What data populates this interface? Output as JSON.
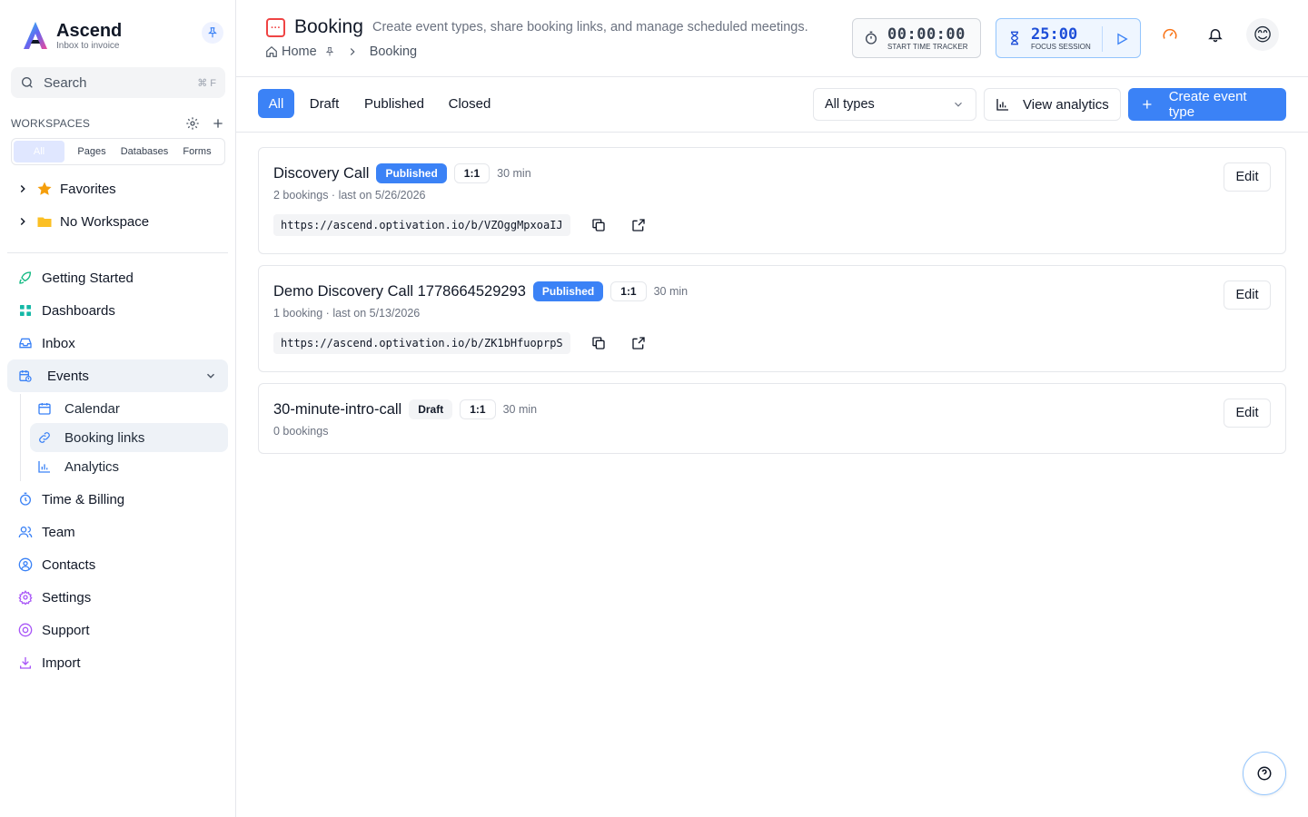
{
  "brand": {
    "name": "Ascend",
    "tagline": "Inbox to invoice"
  },
  "search": {
    "placeholder": "Search",
    "shortcut": "⌘ F"
  },
  "workspaces": {
    "title": "WORKSPACES",
    "tabs": [
      "All",
      "Pages",
      "Databases",
      "Forms"
    ],
    "tree": [
      {
        "label": "Favorites",
        "icon": "star-icon"
      },
      {
        "label": "No Workspace",
        "icon": "folder-icon"
      }
    ]
  },
  "nav": {
    "items": [
      {
        "label": "Getting Started",
        "icon": "rocket-icon"
      },
      {
        "label": "Dashboards",
        "icon": "grid-icon"
      },
      {
        "label": "Inbox",
        "icon": "inbox-icon"
      },
      {
        "label": "Events",
        "icon": "calendar-clock-icon"
      }
    ],
    "events_sub": [
      {
        "label": "Calendar",
        "icon": "calendar-icon"
      },
      {
        "label": "Booking links",
        "icon": "link-icon"
      },
      {
        "label": "Analytics",
        "icon": "bar-chart-icon"
      }
    ],
    "items_after": [
      {
        "label": "Time & Billing",
        "icon": "stopwatch-icon"
      },
      {
        "label": "Team",
        "icon": "users-icon"
      },
      {
        "label": "Contacts",
        "icon": "contact-icon"
      },
      {
        "label": "Settings",
        "icon": "gear-icon"
      },
      {
        "label": "Support",
        "icon": "lifebuoy-icon"
      },
      {
        "label": "Import",
        "icon": "download-icon"
      }
    ]
  },
  "header": {
    "title": "Booking",
    "description": "Create event types, share booking links, and manage scheduled meetings.",
    "breadcrumb": [
      "Home",
      "Booking"
    ]
  },
  "timer": {
    "value": "00:00:00",
    "label": "START TIME TRACKER"
  },
  "focus": {
    "value": "25:00",
    "label": "FOCUS SESSION"
  },
  "filters": {
    "tabs": [
      "All",
      "Draft",
      "Published",
      "Closed"
    ],
    "active_tab": "All",
    "type_select": "All types",
    "analytics_label": "View analytics",
    "create_label": "Create event type"
  },
  "events": [
    {
      "title": "Discovery Call",
      "status": "Published",
      "ratio": "1:1",
      "duration": "30 min",
      "meta": "2 bookings · last on 5/26/2026",
      "link": "https://ascend.optivation.io/b/VZOggMpxoaIJ",
      "edit": "Edit"
    },
    {
      "title": "Demo Discovery Call 1778664529293",
      "status": "Published",
      "ratio": "1:1",
      "duration": "30 min",
      "meta": "1 booking · last on 5/13/2026",
      "link": "https://ascend.optivation.io/b/ZK1bHfuoprpS",
      "edit": "Edit"
    },
    {
      "title": "30-minute-intro-call",
      "status": "Draft",
      "ratio": "1:1",
      "duration": "30 min",
      "meta": "0 bookings",
      "edit": "Edit"
    }
  ],
  "colors": {
    "accent": "#3b82f6",
    "page_icon": "#ef4444",
    "focus": "#1d4ed8"
  }
}
